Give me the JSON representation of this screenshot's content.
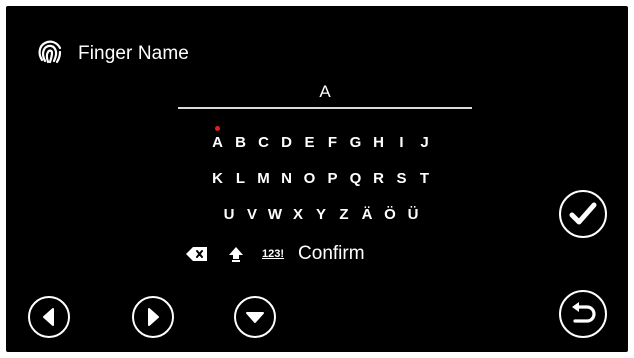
{
  "header": {
    "icon": "fingerprint-icon",
    "title": "Finger Name"
  },
  "input": {
    "value": "A"
  },
  "keyboard": {
    "selected_key": "A",
    "row1": [
      "A",
      "B",
      "C",
      "D",
      "E",
      "F",
      "G",
      "H",
      "I",
      "J"
    ],
    "row2": [
      "K",
      "L",
      "M",
      "N",
      "O",
      "P",
      "Q",
      "R",
      "S",
      "T"
    ],
    "row3": [
      "U",
      "V",
      "W",
      "X",
      "Y",
      "Z",
      "Ä",
      "Ö",
      "Ü"
    ],
    "symbols_label": "123!",
    "confirm_label": "Confirm",
    "backspace_icon": "backspace-icon",
    "shift_icon": "shift-arrow-icon"
  },
  "navigation": {
    "left_icon": "arrow-left-icon",
    "right_icon": "arrow-right-icon",
    "down_icon": "arrow-down-icon",
    "confirm_icon": "checkmark-icon",
    "back_icon": "return-icon"
  },
  "colors": {
    "background": "#000000",
    "foreground": "#ffffff",
    "selection_dot": "#e02020"
  }
}
